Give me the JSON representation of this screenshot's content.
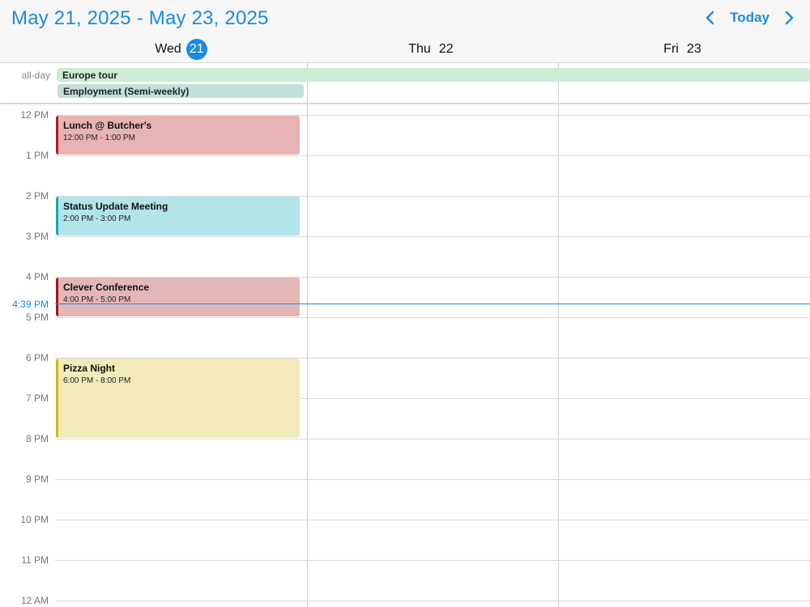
{
  "header": {
    "range_title": "May 21, 2025 - May 23, 2025",
    "today_label": "Today",
    "prev_icon": "chevron-left-icon",
    "next_icon": "chevron-right-icon",
    "accent": "#1a8be0"
  },
  "days": [
    {
      "name": "Wed",
      "num": "21",
      "today": true
    },
    {
      "name": "Thu",
      "num": "22",
      "today": false
    },
    {
      "name": "Fri",
      "num": "23",
      "today": false
    }
  ],
  "allday": {
    "label": "all-day",
    "events": [
      {
        "title": "Europe tour",
        "color": "#cdecd3"
      },
      {
        "title": "Employment (Semi-weekly)",
        "color": "#c2e0d9"
      }
    ]
  },
  "hours": [
    "12 PM",
    "1 PM",
    "2 PM",
    "3 PM",
    "4 PM",
    "5 PM",
    "6 PM",
    "7 PM",
    "8 PM",
    "9 PM",
    "10 PM",
    "11 PM",
    "12 AM"
  ],
  "events": [
    {
      "title": "Lunch @ Butcher's",
      "time": "12:00 PM - 1:00 PM",
      "bg": "#e8b3b3",
      "bar": "#b01c1c"
    },
    {
      "title": "Status Update Meeting",
      "time": "2:00 PM - 3:00 PM",
      "bg": "#b2e4e8",
      "bar": "#1aa8b0"
    },
    {
      "title": "Clever Conference",
      "time": "4:00 PM - 5:00 PM",
      "bg": "#e3b7b7",
      "bar": "#a01818"
    },
    {
      "title": "Pizza Night",
      "time": "6:00 PM - 8:00 PM",
      "bg": "#f2eab8",
      "bar": "#d4b800"
    }
  ],
  "now": {
    "label": "4:39 PM"
  }
}
